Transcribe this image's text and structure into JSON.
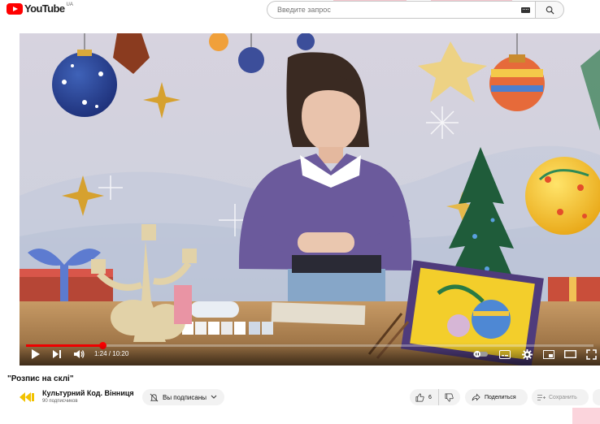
{
  "masthead": {
    "logo_text": "YouTube",
    "country_code": "UA",
    "search_placeholder": "Введите запрос"
  },
  "player": {
    "time_current": "1:24",
    "time_separator": " / ",
    "time_total": "10:20",
    "progress_fraction": 0.135
  },
  "video": {
    "title": "\"Розпис на склі\""
  },
  "channel": {
    "name": "Культурний Код. Вінниця",
    "subscribers": "90 подписчиков",
    "subscribed_label": "Вы подписаны"
  },
  "actions": {
    "like_count": "6",
    "share_label": "Поделиться",
    "save_label": "Сохранить"
  },
  "colors": {
    "brand": "#ff0000",
    "progress": "#ff0000",
    "chip": "#f2f2f2"
  },
  "icons": [
    "youtube-logo-icon",
    "keyboard-icon",
    "search-icon",
    "play-icon",
    "next-icon",
    "volume-icon",
    "subtitles-toggle-icon",
    "captions-icon",
    "gear-icon",
    "miniplayer-icon",
    "theater-icon",
    "fullscreen-icon",
    "bell-off-icon",
    "chevron-down-icon",
    "thumbs-up-icon",
    "thumbs-down-icon",
    "share-icon",
    "save-playlist-icon"
  ]
}
